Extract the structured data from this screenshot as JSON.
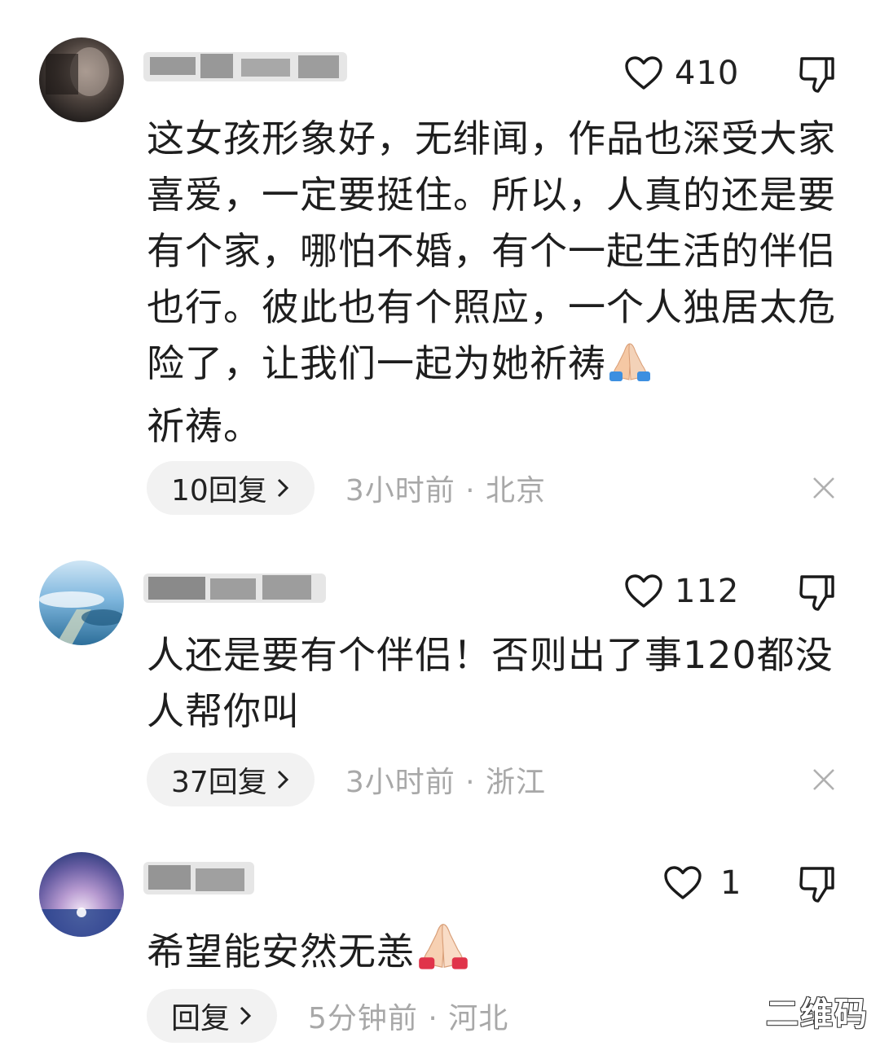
{
  "comments": [
    {
      "likes": "410",
      "text": "这女孩形象好，无绯闻，作品也深受大家喜爱，一定要挺住。所以，人真的还是要有个家，哪怕不婚，有个一起生活的伴侣也行。彼此也有个照应，一个人独居太危险了，让我们一起为她祈祷",
      "text_tail": "祈祷。",
      "reply_label": "10回复",
      "time_location": "3小时前 · 北京"
    },
    {
      "likes": "112",
      "text": "人还是要有个伴侣！否则出了事120都没人帮你叫",
      "reply_label": "37回复",
      "time_location": "3小时前 · 浙江"
    },
    {
      "likes": "1",
      "text": "希望能安然无恙",
      "reply_label": "回复",
      "time_location": "5分钟前 · 河北"
    }
  ],
  "watermark": "二维码",
  "icons": {
    "like": "heart-outline-icon",
    "dislike": "thumbs-down-icon",
    "close": "close-icon",
    "reply_arrow": "chevron-right-icon",
    "prayer_emoji": "folded-hands-emoji"
  },
  "colors": {
    "meta_gray": "#a8a8a8",
    "pill_bg": "#f2f2f2",
    "text": "#1e1e1e"
  }
}
